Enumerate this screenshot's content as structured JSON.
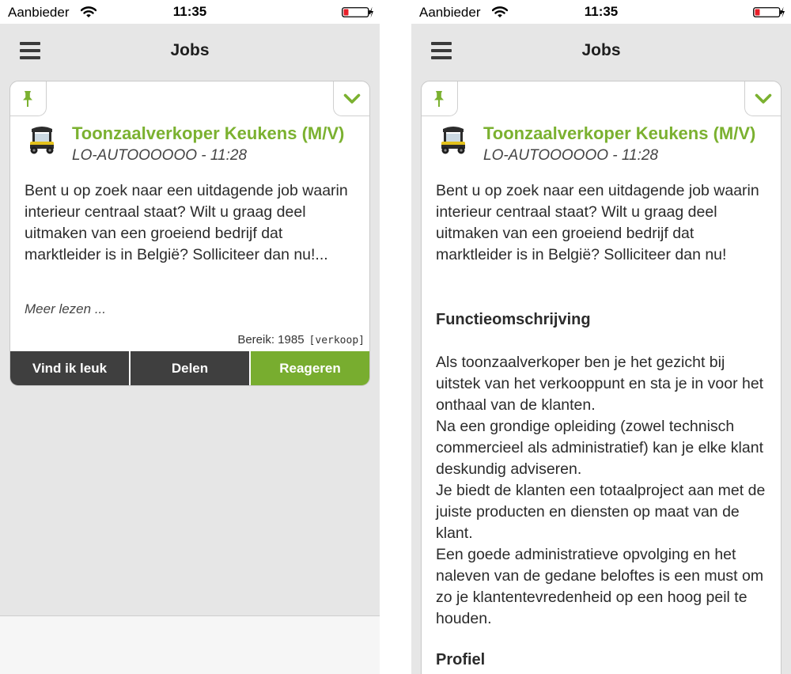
{
  "status_bar": {
    "carrier": "Aanbieder",
    "time": "11:35"
  },
  "header": {
    "title": "Jobs"
  },
  "job": {
    "title": "Toonzaalverkoper Keukens (M/V)",
    "meta": "LO-AUTOOOOOO - 11:28",
    "summary": "Bent u op zoek naar een uitdagende job waarin interieur centraal staat? Wilt u graag deel uitmaken van een groeiend bedrijf dat marktleider is in België? Solliciteer dan nu!...",
    "intro": "Bent u op zoek naar een uitdagende job waarin interieur centraal staat? Wilt u graag deel uitmaken van een groeiend bedrijf dat marktleider is in België? Solliciteer dan nu!",
    "read_more": "Meer lezen ...",
    "reach_label": "Bereik: 1985",
    "category_tag": "[verkoop]",
    "function_heading": "Functieomschrijving",
    "function_text": "Als toonzaalverkoper ben je het gezicht bij uitstek van het verkooppunt en sta je in voor het onthaal van de klanten.\nNa een grondige opleiding (zowel technisch commercieel als administratief) kan je elke klant deskundig adviseren.\nJe biedt de klanten een totaalproject aan met de juiste producten en diensten op maat van de klant.\nEen goede administratieve opvolging en het naleven van de gedane beloftes is een must om zo je klantentevredenheid op een hoog peil te houden.",
    "profile_heading": "Profiel"
  },
  "actions": {
    "like": "Vind ik leuk",
    "share": "Delen",
    "respond": "Reageren"
  },
  "colors": {
    "accent": "#7bb130",
    "dark_button": "#3f3f3f",
    "background": "#e6e6e6"
  },
  "icons": [
    "wifi-icon",
    "battery-icon",
    "charging-icon",
    "menu-icon",
    "pin-icon",
    "chevron-down-icon",
    "tuktuk-icon"
  ]
}
